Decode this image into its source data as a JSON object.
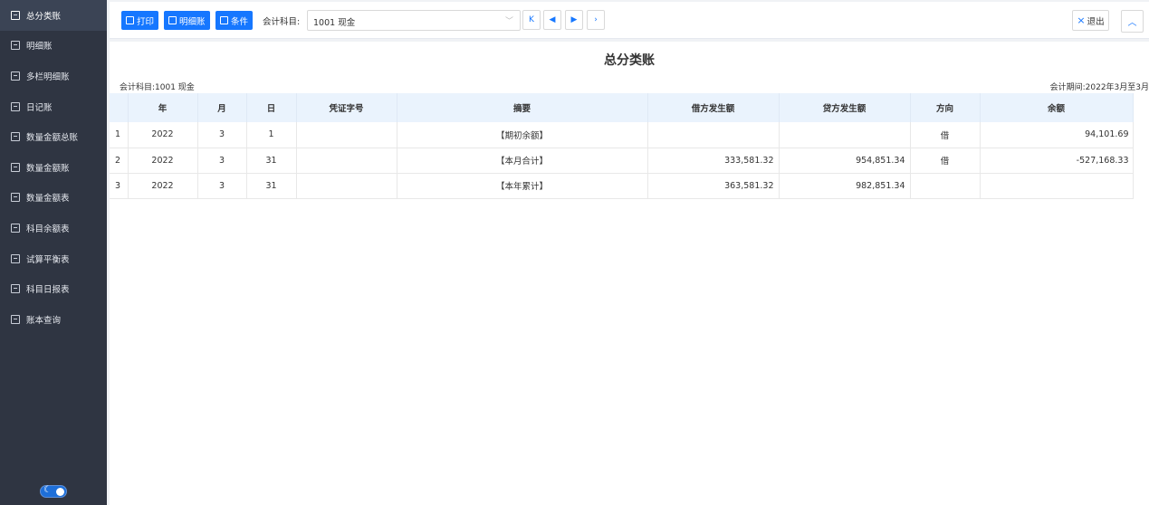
{
  "sidebar": {
    "items": [
      {
        "label": "总分类账",
        "icon": "ledger-icon"
      },
      {
        "label": "明细账",
        "icon": "detail-ledger-icon"
      },
      {
        "label": "多栏明细账",
        "icon": "bar-chart-icon"
      },
      {
        "label": "日记账",
        "icon": "journal-icon"
      },
      {
        "label": "数量金额总账",
        "icon": "quantity-ledger-icon"
      },
      {
        "label": "数量金额账",
        "icon": "quantity-account-icon"
      },
      {
        "label": "数量金额表",
        "icon": "quantity-table-icon"
      },
      {
        "label": "科目余额表",
        "icon": "balance-table-icon"
      },
      {
        "label": "试算平衡表",
        "icon": "trial-balance-icon"
      },
      {
        "label": "科目日报表",
        "icon": "daily-report-icon"
      },
      {
        "label": "账本查询",
        "icon": "book-query-icon"
      }
    ],
    "theme_toggle_icon": "moon-icon"
  },
  "toolbar": {
    "print_label": "打印",
    "detail_label": "明细账",
    "condition_label": "条件",
    "subject_label": "会计科目:",
    "subject_value": "1001 现金",
    "first_icon": "K",
    "prev_icon": "◀",
    "next_icon": "▶",
    "last_icon": "›",
    "exit_label": "退出",
    "collapse_icon": "︿"
  },
  "report": {
    "title": "总分类账",
    "subject_meta": "会计科目:1001 现金",
    "period_meta": "会计期间:2022年3月至3月"
  },
  "table": {
    "headers": [
      "",
      "年",
      "月",
      "日",
      "凭证字号",
      "摘要",
      "借方发生额",
      "贷方发生额",
      "方向",
      "余额"
    ],
    "rows": [
      [
        "1",
        "2022",
        "3",
        "1",
        "",
        "【期初余额】",
        "",
        "",
        "借",
        "94,101.69"
      ],
      [
        "2",
        "2022",
        "3",
        "31",
        "",
        "【本月合计】",
        "333,581.32",
        "954,851.34",
        "借",
        "-527,168.33"
      ],
      [
        "3",
        "2022",
        "3",
        "31",
        "",
        "【本年累计】",
        "363,581.32",
        "982,851.34",
        "",
        ""
      ]
    ]
  },
  "colors": {
    "accent": "#1677ff",
    "sidebar_bg": "#2f3542",
    "header_bg": "#eaf3fd"
  }
}
